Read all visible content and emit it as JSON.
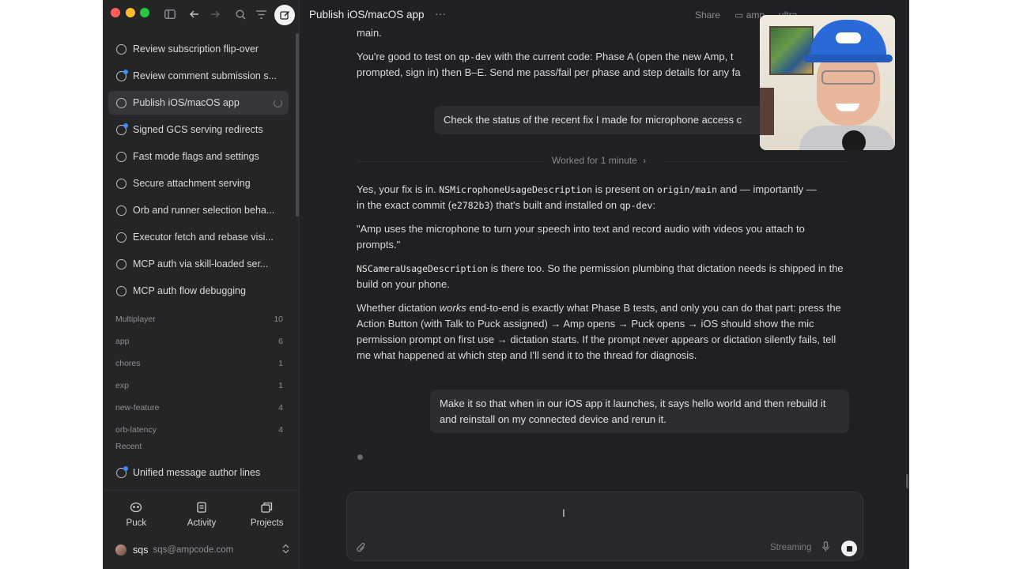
{
  "window": {
    "title": "Publish iOS/macOS app",
    "more_label": "···",
    "toolbar_right": {
      "share": "Share",
      "folder": "amp",
      "branch": "ultra"
    }
  },
  "sidebar": {
    "threads": [
      {
        "label": "Review subscription flip-over",
        "unread": false
      },
      {
        "label": "Review comment submission s...",
        "unread": true
      },
      {
        "label": "Publish iOS/macOS app",
        "unread": false,
        "active": true,
        "running": true
      },
      {
        "label": "Signed GCS serving redirects",
        "unread": true
      },
      {
        "label": "Fast mode flags and settings",
        "unread": false
      },
      {
        "label": "Secure attachment serving",
        "unread": false
      },
      {
        "label": "Orb and runner selection beha...",
        "unread": false
      },
      {
        "label": "Executor fetch and rebase visi...",
        "unread": false
      },
      {
        "label": "MCP auth via skill-loaded ser...",
        "unread": false
      },
      {
        "label": "MCP auth flow debugging",
        "unread": false
      }
    ],
    "groups": [
      {
        "name": "Multiplayer",
        "count": "10"
      },
      {
        "name": "app",
        "count": "6"
      },
      {
        "name": "chores",
        "count": "1"
      },
      {
        "name": "exp",
        "count": "1"
      },
      {
        "name": "new-feature",
        "count": "4"
      },
      {
        "name": "orb-latency",
        "count": "4"
      }
    ],
    "recent_label": "Recent",
    "recent_thread": "Unified message author lines",
    "nav": {
      "puck": "Puck",
      "activity": "Activity",
      "projects": "Projects"
    },
    "account": {
      "name": "sqs",
      "email": "sqs@ampcode.com"
    }
  },
  "conversation": {
    "prev_tail": "main.",
    "prev_para": {
      "t1": "You're good to test on ",
      "c1": "qp-dev",
      "t2": " with the current code: Phase A (open the new Amp, t",
      "t3": "prompted, sign in) then B–E. Send me pass/fail per phase and step details for any fa"
    },
    "user_msg_1": "Check the status of the recent fix I made for microphone access c",
    "worked_label": "Worked for 1 minute",
    "reply": {
      "p1": {
        "t1": "Yes, your fix is in. ",
        "c1": "NSMicrophoneUsageDescription",
        "t2": " is present on ",
        "c2": "origin/main",
        "t3": " and — importantly —",
        "t4": "in the exact commit (",
        "c3": "e2782b3",
        "t5": ") that's built and installed on ",
        "c4": "qp-dev",
        "t6": ":"
      },
      "quote": "\"Amp uses the microphone to turn your speech into text and record audio with videos you attach to prompts.\"",
      "p3": {
        "c1": "NSCameraUsageDescription",
        "t1": " is there too. So the permission plumbing that dictation needs is shipped in the build on your phone."
      },
      "p4": {
        "t1": "Whether dictation ",
        "em": "works",
        "t2": " end-to-end is exactly what Phase B tests, and only you can do that part: press the Action Button (with Talk to Puck assigned) → Amp opens → Puck opens → iOS should show the mic permission prompt on first use → dictation starts. If the prompt never appears or dictation silently fails, tell me what happened at which step and I'll send it to the thread for diagnosis."
      }
    },
    "user_msg_2": "Make it so that when in our iOS app it launches, it says hello world and then rebuild it and reinstall on my connected device and rerun it."
  },
  "composer": {
    "value": "",
    "placeholder": "",
    "status": "Streaming"
  },
  "colors": {
    "accent_unread": "#3a8dff",
    "background": "#1f2023",
    "sidebar": "#242527"
  }
}
